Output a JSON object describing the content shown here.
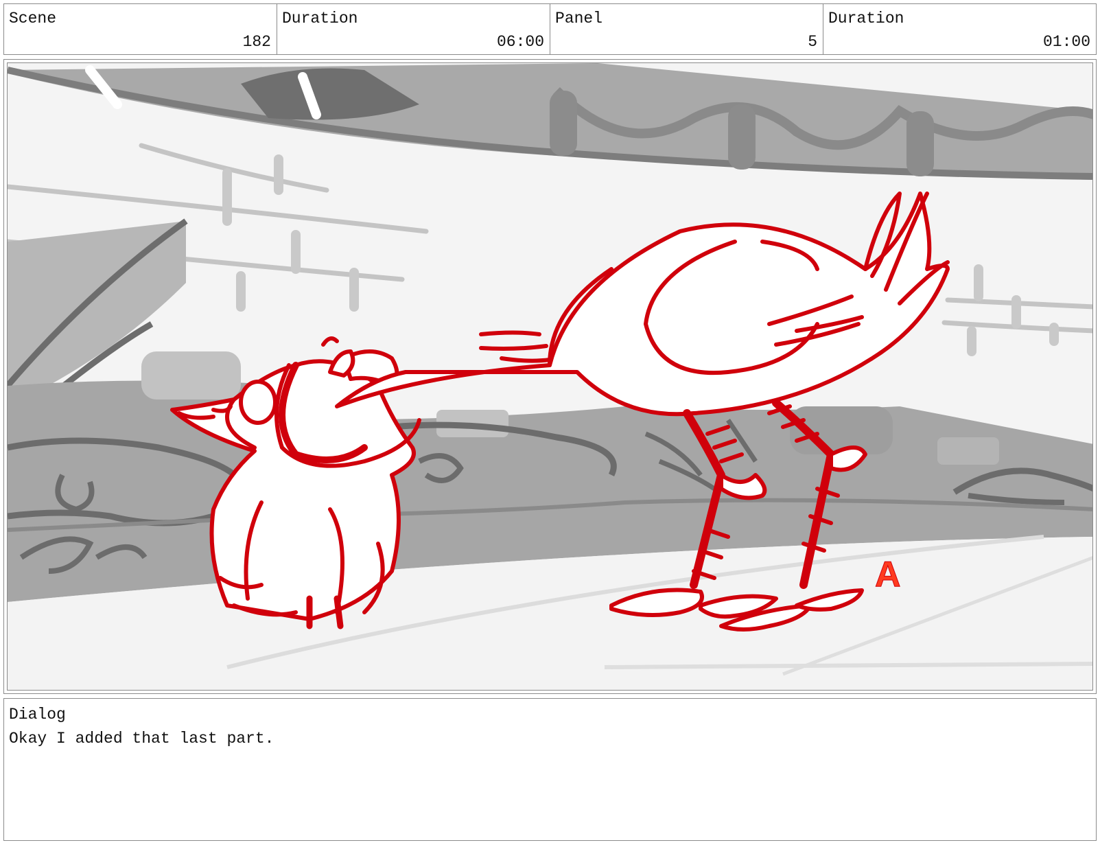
{
  "header": {
    "scene": {
      "label": "Scene",
      "value": "182"
    },
    "scene_duration": {
      "label": "Duration",
      "value": "06:00"
    },
    "panel": {
      "label": "Panel",
      "value": "5"
    },
    "panel_duration": {
      "label": "Duration",
      "value": "01:00"
    }
  },
  "panel_image": {
    "camera_mark": "A",
    "line_color": "#d0000b",
    "background_tones": [
      "#f4f4f4",
      "#c8c8c8",
      "#9a9a9a",
      "#6e6e6e"
    ]
  },
  "dialog": {
    "label": "Dialog",
    "text": "Okay I added that last part."
  }
}
